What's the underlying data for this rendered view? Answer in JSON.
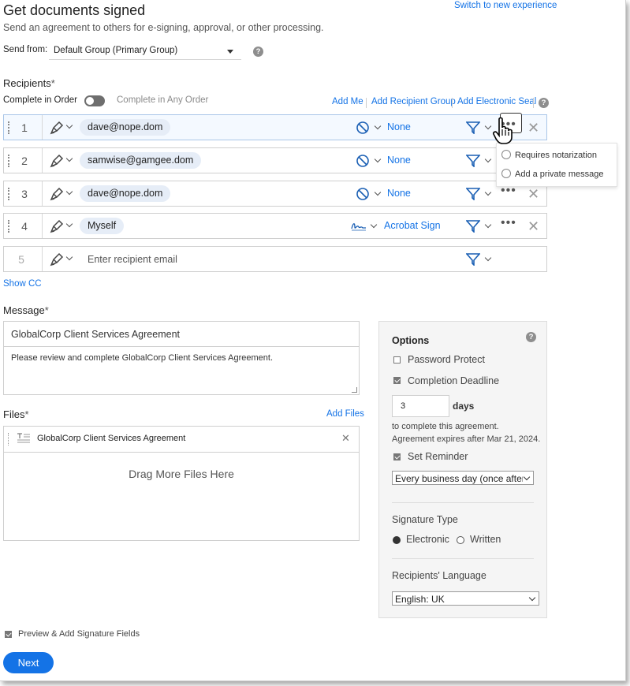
{
  "header": {
    "title": "Get documents signed",
    "subtitle": "Send an agreement to others for e-signing, approval, or other processing.",
    "switch_link": "Switch to new experience"
  },
  "send_from": {
    "label": "Send from:",
    "value": "Default Group (Primary Group)"
  },
  "recipients": {
    "label": "Recipients",
    "required_mark": "*",
    "complete_in_order": "Complete in Order",
    "complete_any_order": "Complete in Any Order",
    "toggle_on": false,
    "links": {
      "add_me": "Add Me",
      "add_group": "Add Recipient Group",
      "add_seal": "Add Electronic Seal"
    },
    "rows": [
      {
        "num": "1",
        "email": "dave@nope.dom",
        "auth": "None",
        "auth_icon": "prohibit-icon",
        "active": true
      },
      {
        "num": "2",
        "email": "samwise@gamgee.dom",
        "auth": "None",
        "auth_icon": "prohibit-icon"
      },
      {
        "num": "3",
        "email": "dave@nope.dom",
        "auth": "None",
        "auth_icon": "prohibit-icon"
      },
      {
        "num": "4",
        "email": "Myself",
        "auth": "Acrobat Sign",
        "auth_icon": "signature-icon"
      },
      {
        "num": "5",
        "placeholder": "Enter recipient email"
      }
    ],
    "menu": {
      "item_notarization": "Requires notarization",
      "item_private_message": "Add a private message"
    },
    "show_cc": "Show CC"
  },
  "message": {
    "label": "Message",
    "required_mark": "*",
    "subject": "GlobalCorp Client Services Agreement",
    "body": "Please review and complete GlobalCorp Client Services Agreement."
  },
  "files": {
    "label": "Files",
    "required_mark": "*",
    "add_files": "Add Files",
    "items": [
      {
        "name": "GlobalCorp Client Services Agreement"
      }
    ],
    "drag_text": "Drag More Files Here"
  },
  "options": {
    "title": "Options",
    "password_protect": "Password Protect",
    "password_checked": false,
    "completion_deadline": "Completion Deadline",
    "deadline_checked": true,
    "days_value": "3",
    "days_label": "days",
    "deadline_note_1": "to complete this agreement.",
    "deadline_note_2": "Agreement expires after Mar 21, 2024.",
    "set_reminder": "Set Reminder",
    "reminder_checked": true,
    "reminder_value": "Every business day (once after",
    "signature_type_label": "Signature Type",
    "electronic": "Electronic",
    "written": "Written",
    "signature_selected": "Electronic",
    "language_label": "Recipients' Language",
    "language_value": "English: UK"
  },
  "footer": {
    "preview_label": "Preview & Add Signature Fields",
    "preview_checked": true,
    "next": "Next"
  },
  "colors": {
    "accent": "#1473e6",
    "pill_bg": "#e6edf7",
    "options_bg": "#f5f5f5"
  }
}
